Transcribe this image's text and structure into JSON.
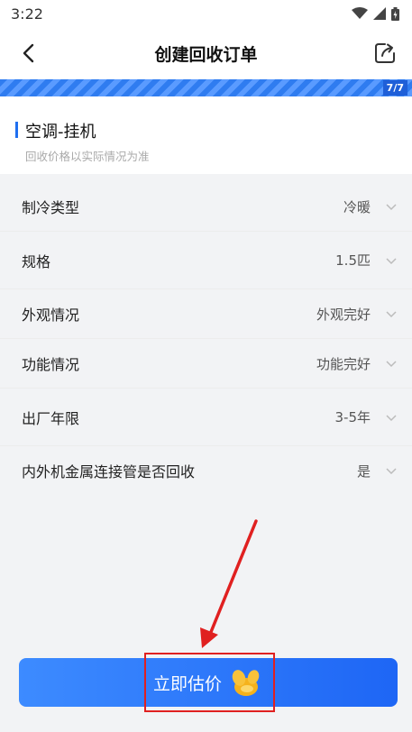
{
  "status_bar": {
    "time": "3:22"
  },
  "header": {
    "title": "创建回收订单"
  },
  "progress": {
    "label": "7/7",
    "current": 7,
    "total": 7
  },
  "product": {
    "name": "空调-挂机",
    "note": "回收价格以实际情况为准"
  },
  "attributes": [
    {
      "label": "制冷类型",
      "value": "冷暖"
    },
    {
      "label": "规格",
      "value": "1.5匹"
    },
    {
      "label": "外观情况",
      "value": "外观完好"
    },
    {
      "label": "功能情况",
      "value": "功能完好"
    },
    {
      "label": "出厂年限",
      "value": "3-5年"
    },
    {
      "label": "内外机金属连接管是否回收",
      "value": "是"
    }
  ],
  "action": {
    "label": "立即估价"
  },
  "colors": {
    "accent": "#1e66f5",
    "highlight": "#e02020"
  }
}
